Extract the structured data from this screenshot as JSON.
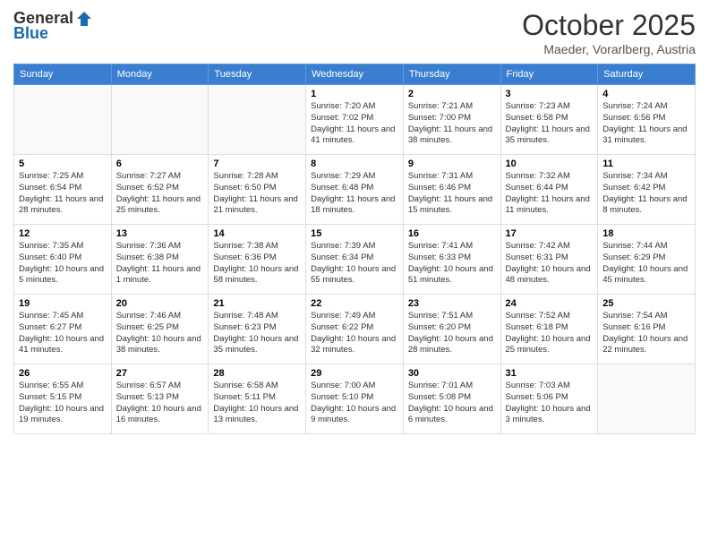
{
  "header": {
    "logo_general": "General",
    "logo_blue": "Blue",
    "month_title": "October 2025",
    "location": "Maeder, Vorarlberg, Austria"
  },
  "days_of_week": [
    "Sunday",
    "Monday",
    "Tuesday",
    "Wednesday",
    "Thursday",
    "Friday",
    "Saturday"
  ],
  "weeks": [
    [
      {
        "day": "",
        "empty": true
      },
      {
        "day": "",
        "empty": true
      },
      {
        "day": "",
        "empty": true
      },
      {
        "day": "1",
        "sunrise": "7:20 AM",
        "sunset": "7:02 PM",
        "daylight": "11 hours and 41 minutes."
      },
      {
        "day": "2",
        "sunrise": "7:21 AM",
        "sunset": "7:00 PM",
        "daylight": "11 hours and 38 minutes."
      },
      {
        "day": "3",
        "sunrise": "7:23 AM",
        "sunset": "6:58 PM",
        "daylight": "11 hours and 35 minutes."
      },
      {
        "day": "4",
        "sunrise": "7:24 AM",
        "sunset": "6:56 PM",
        "daylight": "11 hours and 31 minutes."
      }
    ],
    [
      {
        "day": "5",
        "sunrise": "7:25 AM",
        "sunset": "6:54 PM",
        "daylight": "11 hours and 28 minutes."
      },
      {
        "day": "6",
        "sunrise": "7:27 AM",
        "sunset": "6:52 PM",
        "daylight": "11 hours and 25 minutes."
      },
      {
        "day": "7",
        "sunrise": "7:28 AM",
        "sunset": "6:50 PM",
        "daylight": "11 hours and 21 minutes."
      },
      {
        "day": "8",
        "sunrise": "7:29 AM",
        "sunset": "6:48 PM",
        "daylight": "11 hours and 18 minutes."
      },
      {
        "day": "9",
        "sunrise": "7:31 AM",
        "sunset": "6:46 PM",
        "daylight": "11 hours and 15 minutes."
      },
      {
        "day": "10",
        "sunrise": "7:32 AM",
        "sunset": "6:44 PM",
        "daylight": "11 hours and 11 minutes."
      },
      {
        "day": "11",
        "sunrise": "7:34 AM",
        "sunset": "6:42 PM",
        "daylight": "11 hours and 8 minutes."
      }
    ],
    [
      {
        "day": "12",
        "sunrise": "7:35 AM",
        "sunset": "6:40 PM",
        "daylight": "10 hours and 5 minutes."
      },
      {
        "day": "13",
        "sunrise": "7:36 AM",
        "sunset": "6:38 PM",
        "daylight": "11 hours and 1 minute."
      },
      {
        "day": "14",
        "sunrise": "7:38 AM",
        "sunset": "6:36 PM",
        "daylight": "10 hours and 58 minutes."
      },
      {
        "day": "15",
        "sunrise": "7:39 AM",
        "sunset": "6:34 PM",
        "daylight": "10 hours and 55 minutes."
      },
      {
        "day": "16",
        "sunrise": "7:41 AM",
        "sunset": "6:33 PM",
        "daylight": "10 hours and 51 minutes."
      },
      {
        "day": "17",
        "sunrise": "7:42 AM",
        "sunset": "6:31 PM",
        "daylight": "10 hours and 48 minutes."
      },
      {
        "day": "18",
        "sunrise": "7:44 AM",
        "sunset": "6:29 PM",
        "daylight": "10 hours and 45 minutes."
      }
    ],
    [
      {
        "day": "19",
        "sunrise": "7:45 AM",
        "sunset": "6:27 PM",
        "daylight": "10 hours and 41 minutes."
      },
      {
        "day": "20",
        "sunrise": "7:46 AM",
        "sunset": "6:25 PM",
        "daylight": "10 hours and 38 minutes."
      },
      {
        "day": "21",
        "sunrise": "7:48 AM",
        "sunset": "6:23 PM",
        "daylight": "10 hours and 35 minutes."
      },
      {
        "day": "22",
        "sunrise": "7:49 AM",
        "sunset": "6:22 PM",
        "daylight": "10 hours and 32 minutes."
      },
      {
        "day": "23",
        "sunrise": "7:51 AM",
        "sunset": "6:20 PM",
        "daylight": "10 hours and 28 minutes."
      },
      {
        "day": "24",
        "sunrise": "7:52 AM",
        "sunset": "6:18 PM",
        "daylight": "10 hours and 25 minutes."
      },
      {
        "day": "25",
        "sunrise": "7:54 AM",
        "sunset": "6:16 PM",
        "daylight": "10 hours and 22 minutes."
      }
    ],
    [
      {
        "day": "26",
        "sunrise": "6:55 AM",
        "sunset": "5:15 PM",
        "daylight": "10 hours and 19 minutes."
      },
      {
        "day": "27",
        "sunrise": "6:57 AM",
        "sunset": "5:13 PM",
        "daylight": "10 hours and 16 minutes."
      },
      {
        "day": "28",
        "sunrise": "6:58 AM",
        "sunset": "5:11 PM",
        "daylight": "10 hours and 13 minutes."
      },
      {
        "day": "29",
        "sunrise": "7:00 AM",
        "sunset": "5:10 PM",
        "daylight": "10 hours and 9 minutes."
      },
      {
        "day": "30",
        "sunrise": "7:01 AM",
        "sunset": "5:08 PM",
        "daylight": "10 hours and 6 minutes."
      },
      {
        "day": "31",
        "sunrise": "7:03 AM",
        "sunset": "5:06 PM",
        "daylight": "10 hours and 3 minutes."
      },
      {
        "day": "",
        "empty": true
      }
    ]
  ]
}
